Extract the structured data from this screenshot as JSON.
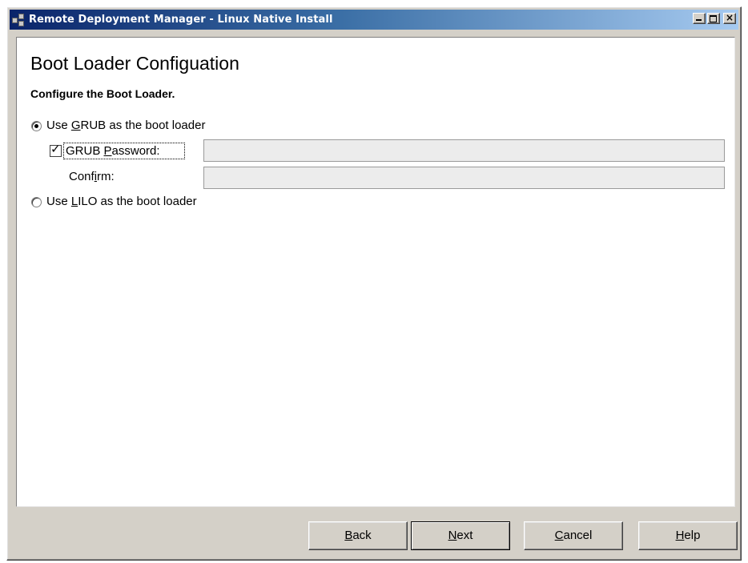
{
  "window": {
    "title": "Remote Deployment Manager - Linux Native Install",
    "controls": {
      "minimize": "_",
      "maximize": "□",
      "close": "×"
    }
  },
  "page": {
    "title": "Boot Loader Configuation",
    "subtitle": "Configure the Boot Loader."
  },
  "options": {
    "grub": {
      "prefix": "Use ",
      "mnemonic": "G",
      "suffix": "RUB as the boot loader",
      "selected": true
    },
    "grub_password": {
      "label_prefix": "GRUB ",
      "label_mnemonic": "P",
      "label_suffix": "assword:",
      "checked": true,
      "value": ""
    },
    "confirm": {
      "label_prefix": "Conf",
      "label_mnemonic": "i",
      "label_suffix": "rm:",
      "value": ""
    },
    "lilo": {
      "prefix": "Use ",
      "mnemonic": "L",
      "suffix": "ILO as the boot loader",
      "selected": false
    }
  },
  "buttons": {
    "back": {
      "mnemonic": "B",
      "rest": "ack"
    },
    "next": {
      "mnemonic": "N",
      "rest": "ext"
    },
    "cancel": {
      "mnemonic": "C",
      "rest": "ancel"
    },
    "help": {
      "mnemonic": "H",
      "rest": "elp"
    }
  }
}
